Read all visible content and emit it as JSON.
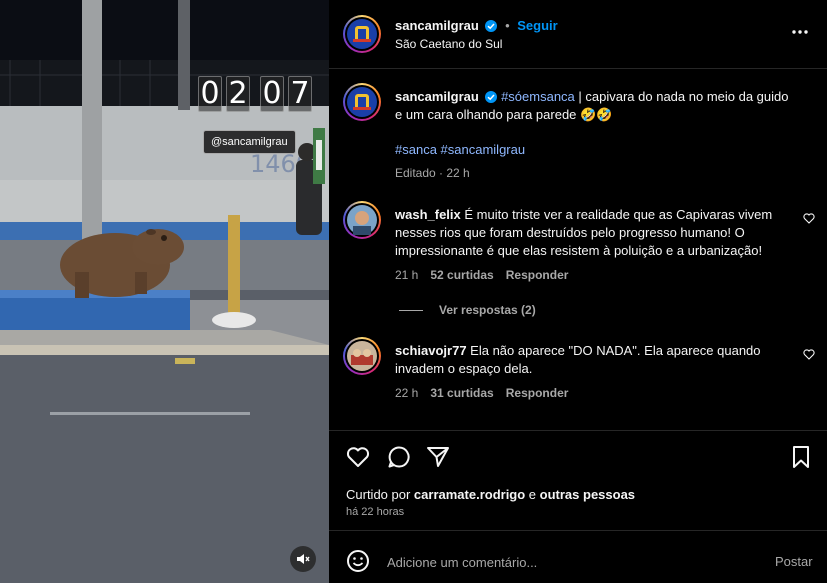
{
  "media": {
    "timestamp_digits": [
      "0",
      "2",
      "0",
      "7"
    ],
    "handle_tag": "@sancamilgrau"
  },
  "header": {
    "username": "sancamilgrau",
    "separator": "•",
    "follow_label": "Seguir",
    "location": "São Caetano do Sul",
    "more_icon": "more-horizontal-icon"
  },
  "caption": {
    "username": "sancamilgrau",
    "hashtag": "#sóemsanca",
    "text": " | capivara do nada no meio da guido e um cara olhando para parede 🤣🤣",
    "tags": [
      "#sanca",
      "#sancamilgrau"
    ],
    "edited": "Editado · 22 h"
  },
  "comments": [
    {
      "username": "wash_felix",
      "text": "É muito triste ver a realidade que as Capivaras vivem nesses rios que foram destruídos pelo progresso humano! O impressionante é que elas resistem à poluição e a urbanização!",
      "time": "21 h",
      "likes": "52 curtidas",
      "reply_label": "Responder",
      "view_replies": "Ver respostas (2)"
    },
    {
      "username": "schiavojr77",
      "text": "Ela não aparece \"DO NADA\". Ela aparece quando invadem o espaço dela.",
      "time": "22 h",
      "likes": "31 curtidas",
      "reply_label": "Responder"
    }
  ],
  "actions": {
    "icons": [
      "heart-icon",
      "comment-icon",
      "share-icon",
      "bookmark-icon"
    ],
    "liked_by_prefix": "Curtido por ",
    "liked_by_user": "carramate.rodrigo",
    "liked_by_mid": " e ",
    "liked_by_others": "outras pessoas",
    "time_ago": "há 22 horas"
  },
  "composer": {
    "placeholder": "Adicione um comentário...",
    "post_label": "Postar",
    "emoji_icon": "emoji-icon"
  },
  "colors": {
    "accent": "#0095f6",
    "hashtag": "#8fb8ff",
    "muted": "#a8a8a8",
    "background": "#000000"
  }
}
